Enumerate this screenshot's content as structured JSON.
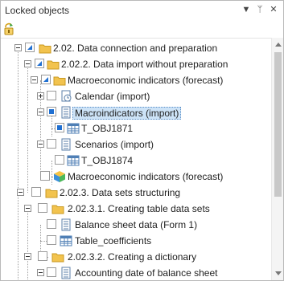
{
  "panel": {
    "title": "Locked objects",
    "dropdown_glyph": "▼",
    "pin_glyph": "ᛘ",
    "close_glyph": "✕"
  },
  "toolbar": {
    "unlock_icon": "unlock-icon"
  },
  "tree": {
    "items": [
      {
        "label": "2.02. Data connection and preparation",
        "icon": "folder-icon"
      },
      {
        "label": "2.02.2. Data import without preparation",
        "icon": "folder-icon"
      },
      {
        "label": "Macroeconomic indicators (forecast)",
        "icon": "folder-icon"
      },
      {
        "label": "Calendar (import)",
        "icon": "calendar-icon"
      },
      {
        "label": "Macroindicators (import)",
        "icon": "database-icon"
      },
      {
        "label": "T_OBJ1871",
        "icon": "table-icon"
      },
      {
        "label": "Scenarios (import)",
        "icon": "database-icon"
      },
      {
        "label": "T_OBJ1874",
        "icon": "table-icon"
      },
      {
        "label": "Macroeconomic indicators (forecast)",
        "icon": "cube-icon"
      },
      {
        "label": "2.02.3. Data sets structuring",
        "icon": "folder-icon"
      },
      {
        "label": "2.02.3.1. Creating table data sets",
        "icon": "folder-icon"
      },
      {
        "label": "Balance sheet data (Form 1)",
        "icon": "database-icon"
      },
      {
        "label": "Table_coefficients",
        "icon": "table-icon"
      },
      {
        "label": "2.02.3.2. Creating a dictionary",
        "icon": "folder-icon"
      },
      {
        "label": "Accounting date of balance sheet",
        "icon": "database-icon"
      }
    ]
  },
  "colors": {
    "accent": "#1f6fd1",
    "folder": "#f2c34e",
    "selection": "#cde3f7"
  }
}
